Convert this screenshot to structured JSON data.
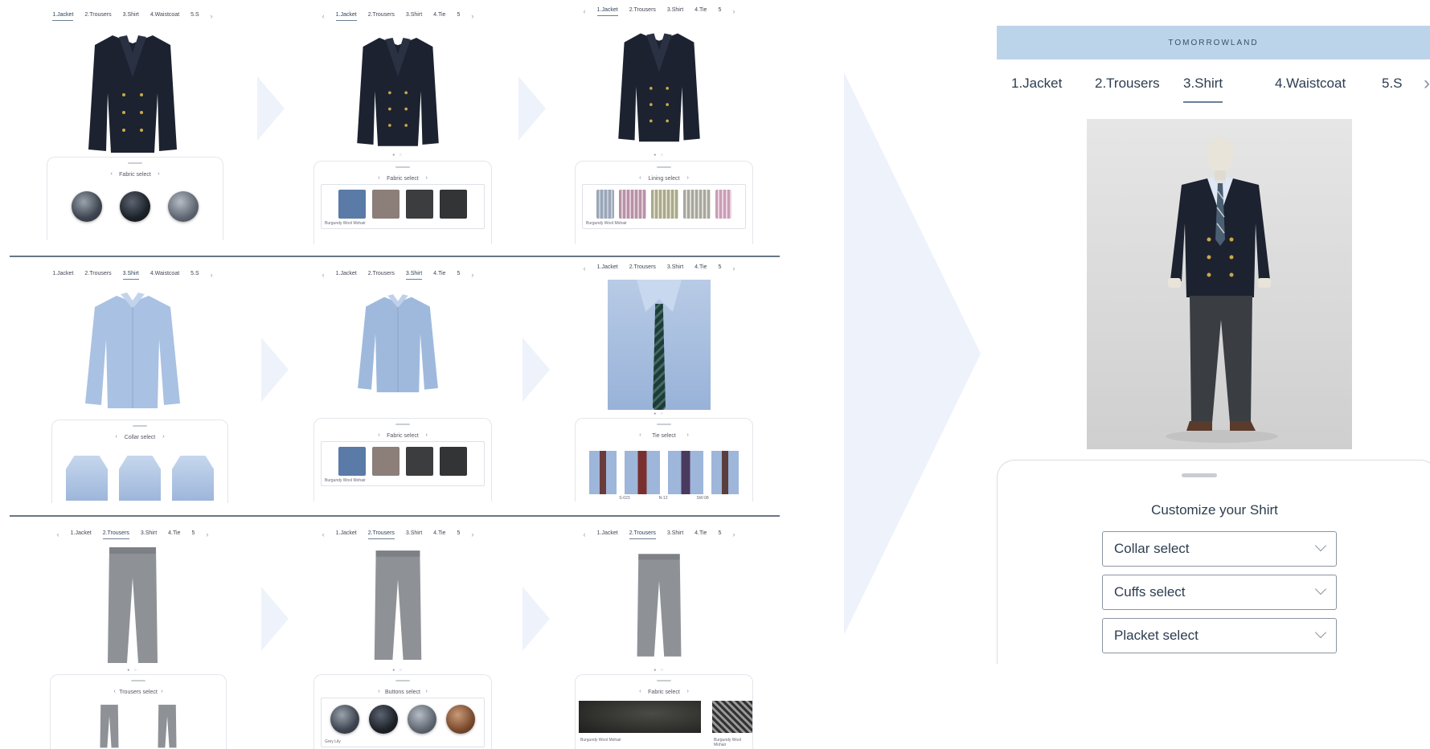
{
  "small_screens": {
    "tabs_row_a": [
      "1.Jacket",
      "2.Trousers",
      "3.Shirt",
      "4.Waistcoat",
      "5.S"
    ],
    "tabs_row_b": [
      "1.Jacket",
      "2.Trousers",
      "3.Shirt",
      "4.Tie",
      "5"
    ],
    "row1": {
      "panel_titles": [
        "Fabric select",
        "Fabric select",
        "Lining select"
      ],
      "fabric_name": "Burgundy Wool Mohair",
      "active_tab": "1.Jacket"
    },
    "row2": {
      "panel_titles": [
        "Collar select",
        "Fabric select",
        "Tie select"
      ],
      "fabric_name": "Burgundy Wool Mohair",
      "tie_labels": [
        "S-023",
        "N-12",
        "SW-08"
      ],
      "active_tab": "3.Shirt"
    },
    "row3": {
      "panel_titles": [
        "Trousers select",
        "Buttons select",
        "Fabric select"
      ],
      "button_label": "Grey Lily",
      "fabric_name": "Burgundy Wool Mohair",
      "active_tab": "2.Trousers"
    }
  },
  "main_screen": {
    "brand": "TOMORROWLAND",
    "tabs": [
      "1.Jacket",
      "2.Trousers",
      "3.Shirt",
      "4.Waistcoat",
      "5.S"
    ],
    "active_tab": "3.Shirt",
    "next_icon": "chevron-right-icon",
    "panel_title": "Customize your Shirt",
    "selects": [
      "Collar select",
      "Cuffs select",
      "Placket select"
    ]
  },
  "colors": {
    "brand_bar": "#bcd4ea",
    "navy_jacket": "#1c2230",
    "shirt_blue": "#a9c1e2",
    "trouser_grey": "#8e9296",
    "fabric_blue": "#5a7aa8",
    "fabric_taupe": "#8c7e78",
    "fabric_charcoal": "#3c3d3f",
    "fabric_dark": "#333436"
  }
}
